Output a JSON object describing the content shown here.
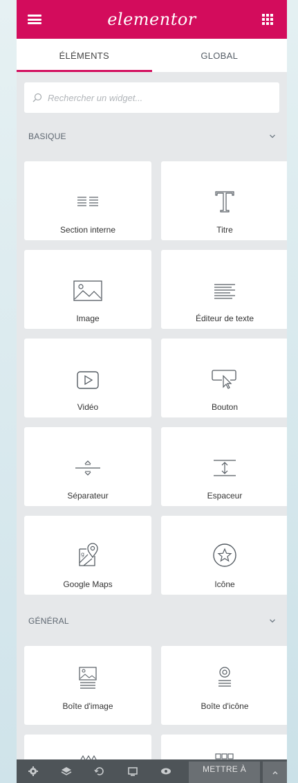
{
  "header": {
    "logo": "elementor"
  },
  "tabs": [
    {
      "label": "ÉLÉMENTS",
      "active": true
    },
    {
      "label": "GLOBAL",
      "active": false
    }
  ],
  "search": {
    "placeholder": "Rechercher un widget..."
  },
  "categories": [
    {
      "title": "BASIQUE",
      "widgets": [
        {
          "label": "Section interne",
          "icon": "columns-icon"
        },
        {
          "label": "Titre",
          "icon": "title-icon"
        },
        {
          "label": "Image",
          "icon": "image-icon"
        },
        {
          "label": "Éditeur de texte",
          "icon": "text-editor-icon"
        },
        {
          "label": "Vidéo",
          "icon": "video-icon"
        },
        {
          "label": "Bouton",
          "icon": "button-icon"
        },
        {
          "label": "Séparateur",
          "icon": "divider-icon"
        },
        {
          "label": "Espaceur",
          "icon": "spacer-icon"
        },
        {
          "label": "Google Maps",
          "icon": "map-icon"
        },
        {
          "label": "Icône",
          "icon": "star-icon"
        }
      ]
    },
    {
      "title": "GÉNÉRAL",
      "widgets": [
        {
          "label": "Boîte d'image",
          "icon": "image-box-icon"
        },
        {
          "label": "Boîte d'icône",
          "icon": "icon-box-icon"
        }
      ]
    }
  ],
  "footer": {
    "publish_label": "METTRE À"
  },
  "colors": {
    "brand": "#d30c5c",
    "footer": "#4e5458"
  }
}
